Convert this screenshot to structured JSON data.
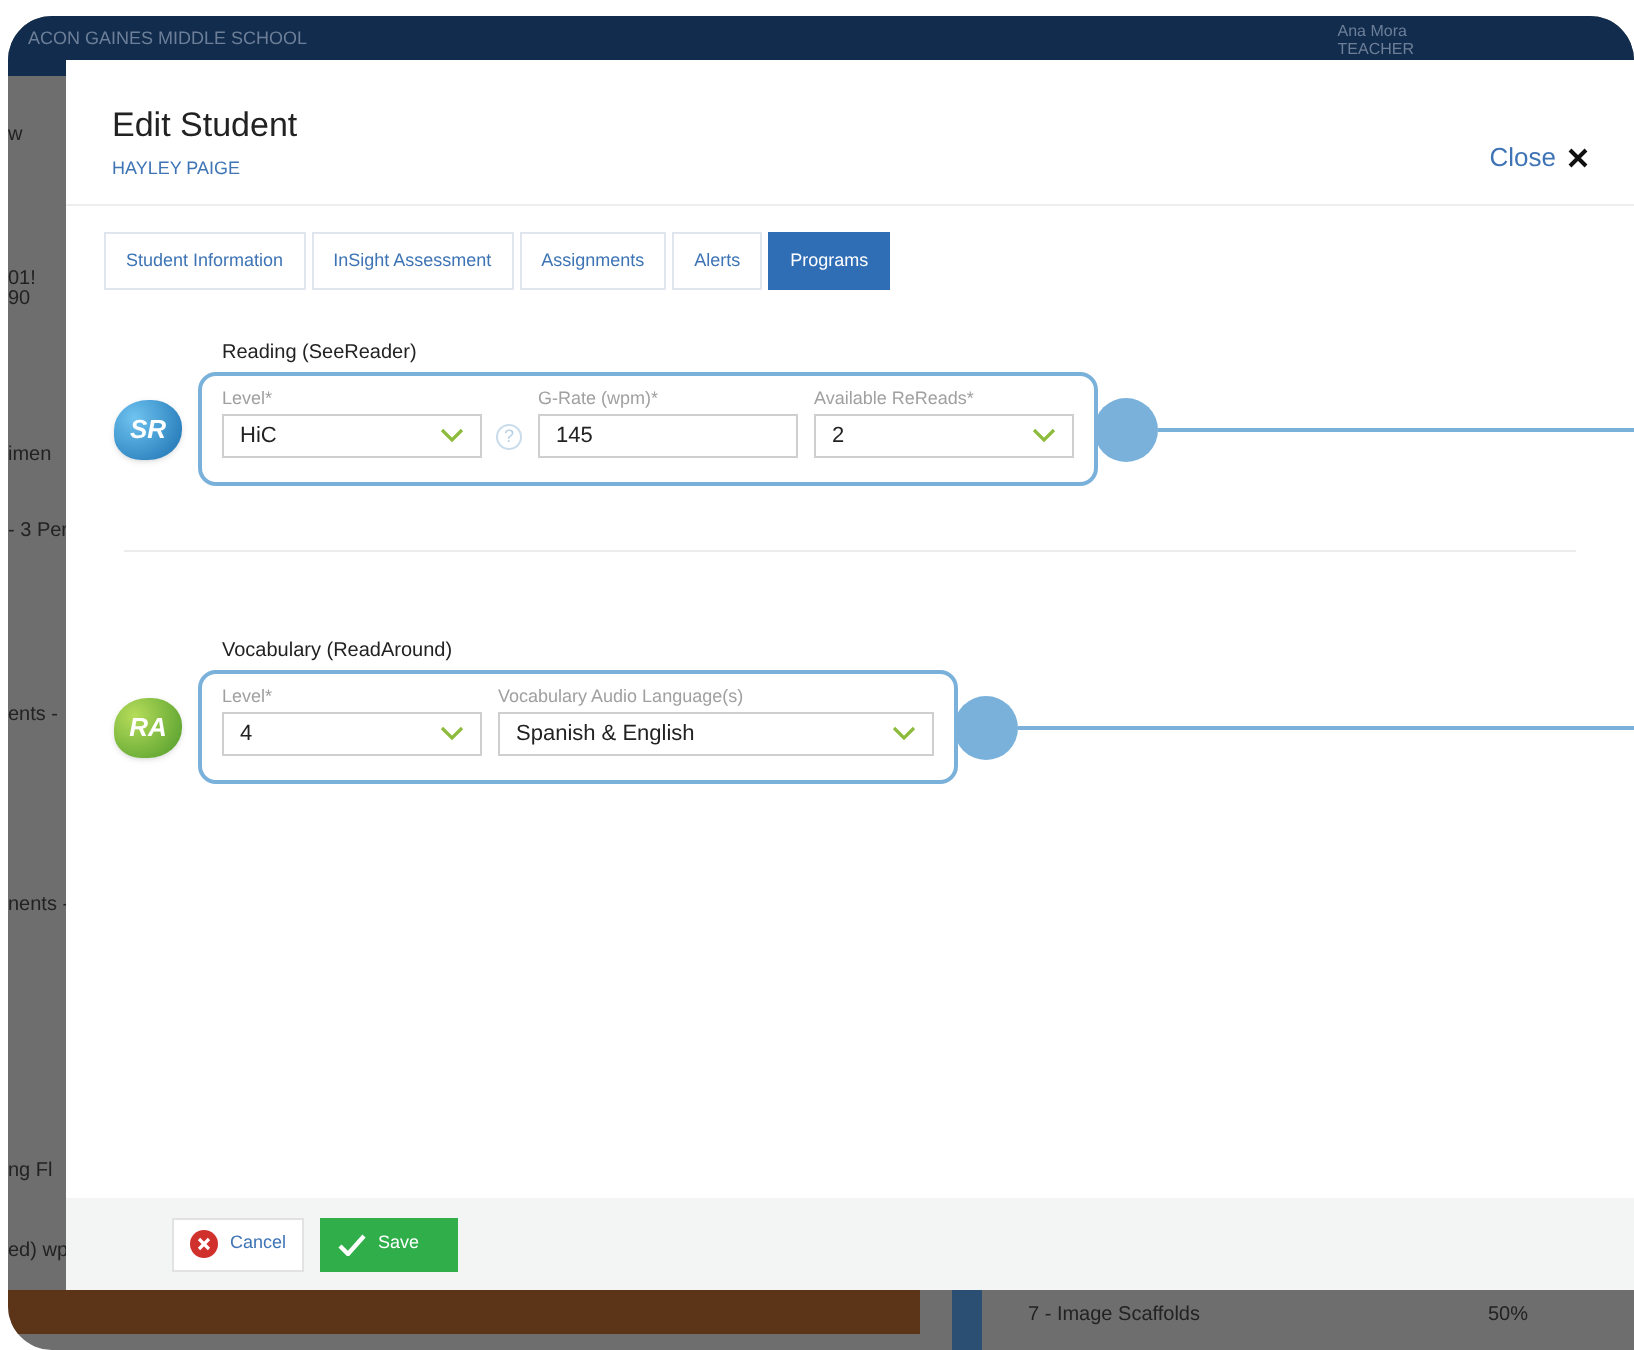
{
  "background": {
    "header": {
      "school": "ACON GAINES MIDDLE SCHOOL",
      "user_name": "Ana Mora",
      "user_role": "TEACHER"
    },
    "left_fragments": [
      "w",
      "01!",
      "90",
      "imen",
      "- 3 Per",
      "ents -",
      "nents -",
      "ng Fl",
      "ed) wp"
    ],
    "bottom_row": {
      "label": "7 - Image Scaffolds",
      "value": "50%"
    }
  },
  "modal": {
    "title": "Edit Student",
    "subtitle": "HAYLEY PAIGE",
    "close": "Close",
    "tabs": [
      {
        "label": "Student Information",
        "selected": false
      },
      {
        "label": "InSight Assessment",
        "selected": false
      },
      {
        "label": "Assignments",
        "selected": false
      },
      {
        "label": "Alerts",
        "selected": false
      },
      {
        "label": "Programs",
        "selected": true
      }
    ],
    "programs": [
      {
        "title": "Reading (SeeReader)",
        "logo": "SR",
        "kind": "reading",
        "fields": [
          {
            "kind": "select",
            "label": "Level*",
            "value": "HiC",
            "help": "?"
          },
          {
            "kind": "input",
            "label": "G-Rate (wpm)*",
            "value": "145"
          },
          {
            "kind": "select",
            "label": "Available ReReads*",
            "value": "2"
          }
        ]
      },
      {
        "title": "Vocabulary (ReadAround)",
        "logo": "RA",
        "kind": "vocabulary",
        "fields": [
          {
            "kind": "select",
            "label": "Level*",
            "value": "4"
          },
          {
            "kind": "select",
            "label": "Vocabulary Audio Language(s)",
            "value": "Spanish & English",
            "wide": true
          }
        ]
      }
    ],
    "buttons": [
      {
        "kind": "cancel",
        "label": "Cancel"
      },
      {
        "kind": "save",
        "label": "Save"
      }
    ]
  }
}
